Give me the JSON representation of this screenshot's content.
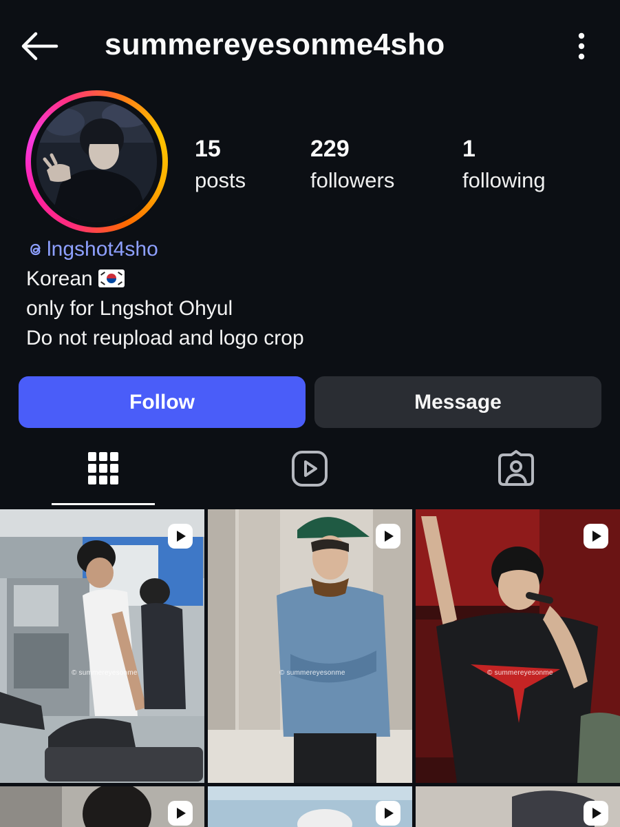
{
  "header": {
    "username": "summereyesonme4sho",
    "back_icon": "arrow-left-icon",
    "more_icon": "kebab-menu-icon"
  },
  "stats": [
    {
      "value": "15",
      "label": "posts"
    },
    {
      "value": "229",
      "label": "followers"
    },
    {
      "value": "1",
      "label": "following"
    }
  ],
  "bio": {
    "threads_handle": "lngshot4sho",
    "line1": "Korean",
    "line2": "only for Lngshot Ohyul",
    "line3": "Do not reupload and logo crop"
  },
  "buttons": {
    "follow": "Follow",
    "message": "Message"
  },
  "tabs": [
    {
      "name": "posts-grid",
      "icon": "grid-icon",
      "active": true
    },
    {
      "name": "reels",
      "icon": "reels-icon",
      "active": false
    },
    {
      "name": "tagged",
      "icon": "tagged-person-icon",
      "active": false
    }
  ],
  "grid": {
    "watermark": "© summereyesonme",
    "watermark_2": "© summereyesonme",
    "watermark_3": "© summereyesonme"
  },
  "colors": {
    "background": "#0c0f14",
    "follow_button": "#4a5df9",
    "message_button": "#2a2d33",
    "threads_link": "#8ea0ff"
  }
}
